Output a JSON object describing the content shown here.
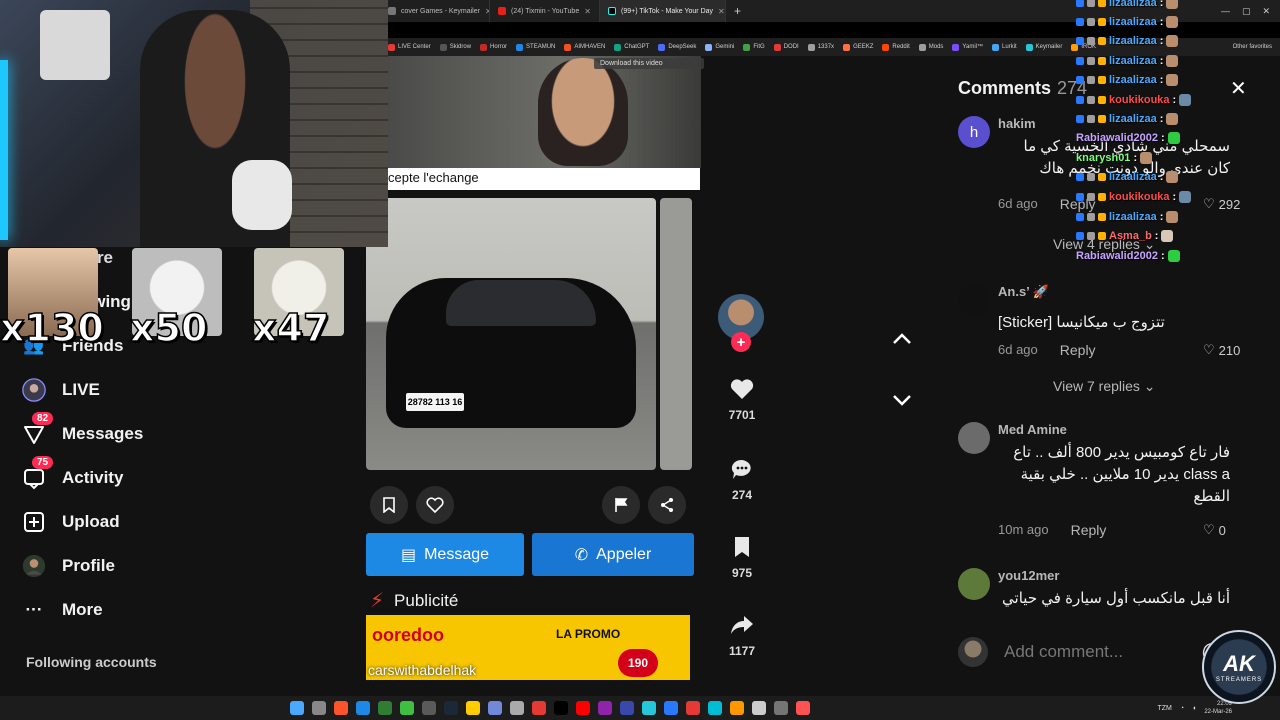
{
  "browser": {
    "tabs": [
      {
        "label": "cover Games - Keymailer",
        "active": false
      },
      {
        "label": "(24) Tixmin - YouTube",
        "active": false
      },
      {
        "label": "(99+) TikTok - Make Your Day",
        "active": true
      }
    ],
    "new_tab_symbol": "+",
    "bookmarks": [
      "LIVE Center",
      "Skidrow",
      "Horror",
      "STEAMUN",
      "AIMHAVEN",
      "ChatGPT",
      "DeepSeek",
      "Gemini",
      "FitG",
      "DODI",
      "1337x",
      "GEEKZ",
      "Reddit",
      "Mods",
      "Yamil™",
      "Lurkit",
      "Keymailer",
      "IROK"
    ],
    "other_favorites": "Other favorites"
  },
  "overlay": {
    "emotes": [
      {
        "count": "x130"
      },
      {
        "count": "x50"
      },
      {
        "count": "x47"
      }
    ],
    "ak_logo": {
      "title": "AK",
      "subtitle": "STREAMERS"
    }
  },
  "sidebar": {
    "partial_items": [
      {
        "label": "xplore",
        "icon": "compass-icon"
      },
      {
        "label": "ollowing",
        "icon": "following-icon"
      },
      {
        "label": "Friends",
        "icon": "friends-icon"
      }
    ],
    "items": [
      {
        "label": "LIVE",
        "icon": "live-icon",
        "badge": ""
      },
      {
        "label": "Messages",
        "icon": "messages-icon",
        "badge": "82"
      },
      {
        "label": "Activity",
        "icon": "activity-icon",
        "badge": "75"
      },
      {
        "label": "Upload",
        "icon": "upload-icon",
        "badge": ""
      },
      {
        "label": "Profile",
        "icon": "profile-icon",
        "badge": ""
      },
      {
        "label": "More",
        "icon": "more-icon",
        "badge": ""
      }
    ],
    "following_accounts_title": "Following accounts"
  },
  "post": {
    "download_label": "Download this video",
    "strip_text": "cepte l'echange",
    "plate": "28782 113 16",
    "message_button": "Message",
    "call_button": "Appeler",
    "publicite": "Publicité",
    "ad": {
      "brand": "ooredoo",
      "promo": "LA PROMO",
      "price": "190"
    },
    "author": "carswithabdelhak"
  },
  "side_actions": {
    "likes": "7701",
    "comments": "274",
    "saves": "975",
    "shares": "1177"
  },
  "comments_panel": {
    "title": "Comments",
    "count": "274",
    "items": [
      {
        "user": "hakim",
        "text": "سمحلي مني شادي الخسية كي ما كان عندي والو دونت نخمم هاك",
        "time": "6d ago",
        "reply": "Reply",
        "likes": "292",
        "view_replies": "View 4 replies"
      },
      {
        "user": "An.s’ 🚀",
        "text": "[Sticker] تتزوج ب ميكانيسا",
        "time": "6d ago",
        "reply": "Reply",
        "likes": "210",
        "view_replies": "View 7 replies"
      },
      {
        "user": "Med Amine",
        "text": "فار تاع كومبيس يدير 800 ألف .. تاع class a يدير 10 ملايين .. خلي بقية القطع",
        "time": "10m ago",
        "reply": "Reply",
        "likes": "0",
        "view_replies": ""
      },
      {
        "user": "you12mer",
        "text": "أنا قبل مانكسب أول سيارة في حياتي",
        "time": "",
        "reply": "",
        "likes": "",
        "view_replies": ""
      }
    ],
    "add_placeholder": "Add comment..."
  },
  "chat": [
    {
      "user": "lizaalizaa",
      "color": "#4aa8ff"
    },
    {
      "user": "lizaalizaa",
      "color": "#4aa8ff"
    },
    {
      "user": "lizaalizaa",
      "color": "#4aa8ff"
    },
    {
      "user": "lizaalizaa",
      "color": "#4aa8ff"
    },
    {
      "user": "lizaalizaa",
      "color": "#4aa8ff"
    },
    {
      "user": "koukikouka",
      "color": "#ff4b4b"
    },
    {
      "user": "lizaalizaa",
      "color": "#4aa8ff"
    },
    {
      "user": "Rabiawalid2002",
      "color": "#c6a4ff"
    },
    {
      "user": "knarysh01",
      "color": "#7cff7c"
    },
    {
      "user": "lizaalizaa",
      "color": "#4aa8ff"
    },
    {
      "user": "koukikouka",
      "color": "#ff4b4b"
    },
    {
      "user": "lizaalizaa",
      "color": "#4aa8ff"
    },
    {
      "user": "Asma_b",
      "color": "#ff6b6b"
    },
    {
      "user": "Rabiawalid2002",
      "color": "#c6a4ff"
    }
  ],
  "taskbar": {
    "lang": "TZM",
    "time": "22:09",
    "date": "22-Mar-26"
  }
}
